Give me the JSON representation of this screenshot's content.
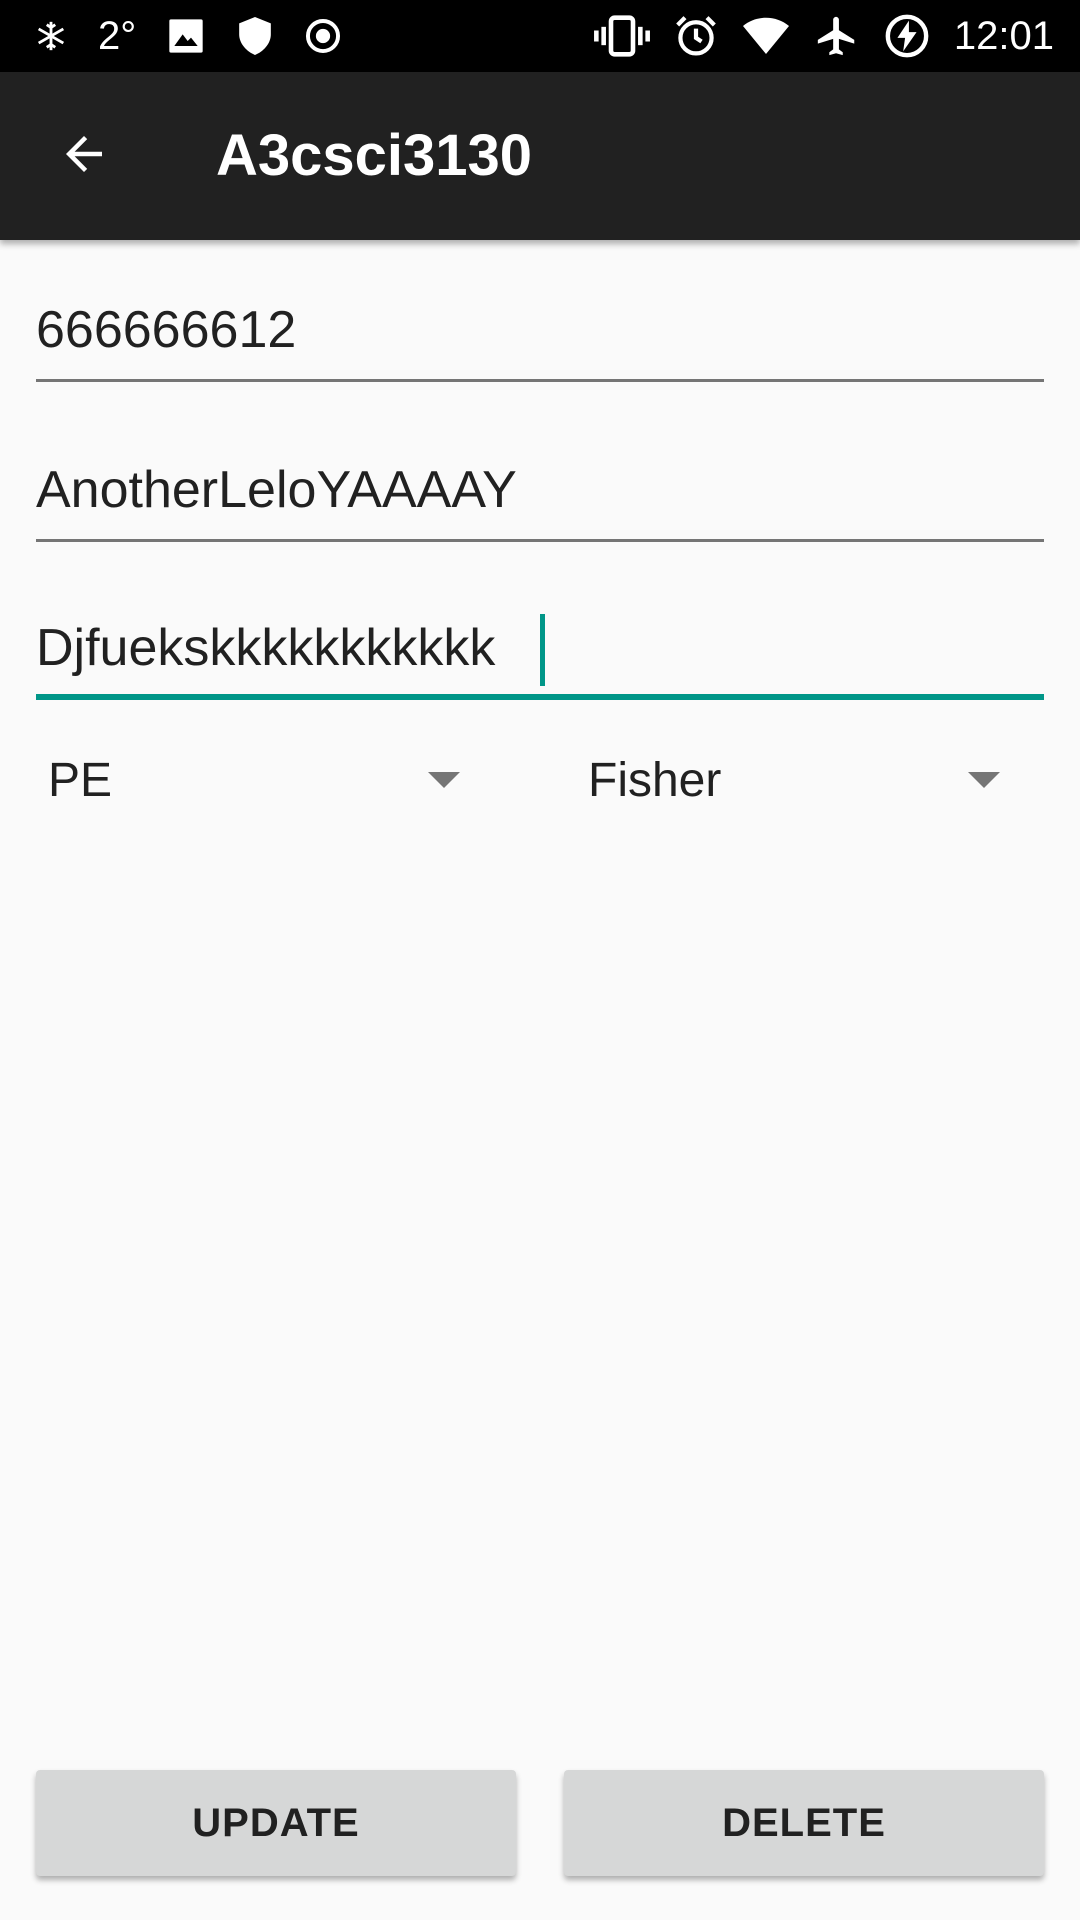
{
  "status_bar": {
    "temperature": "2°",
    "time": "12:01",
    "left_icons": [
      "snowflake-icon",
      "image-icon",
      "shield-icon",
      "record-icon"
    ],
    "right_icons": [
      "vibrate-icon",
      "alarm-icon",
      "wifi-icon",
      "airplane-icon",
      "battery-charging-icon"
    ]
  },
  "app_bar": {
    "title": "A3csci3130",
    "back_icon": "arrow-back-icon"
  },
  "form": {
    "field1_value": "666666612",
    "field2_value": "AnotherLeloYAAAAY",
    "field3_value": "Djfuekskkkkkkkkkkk"
  },
  "spinners": {
    "left_selected": "PE",
    "right_selected": "Fisher"
  },
  "buttons": {
    "update_label": "UPDATE",
    "delete_label": "DELETE"
  },
  "colors": {
    "accent": "#009688",
    "app_bar": "#212121",
    "status_bar": "#000000",
    "background": "#fafafa",
    "button": "#d6d7d7"
  }
}
